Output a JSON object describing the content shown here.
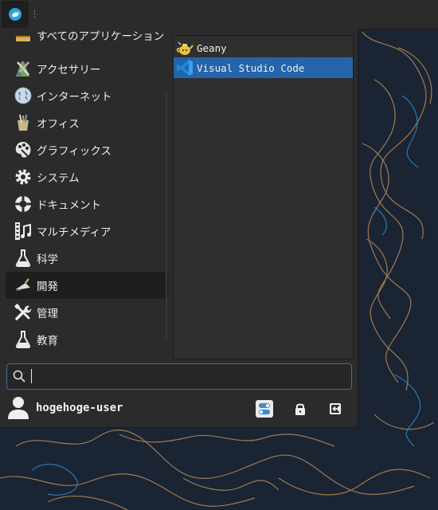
{
  "panel": {
    "menu_button_icon": "xfce-whiskers-icon",
    "separator_glyph": "⋮"
  },
  "categories": [
    {
      "label": "すべてのアプリケーション",
      "icon": "all-apps-icon"
    },
    {
      "label": "アクセサリー",
      "icon": "accessories-icon"
    },
    {
      "label": "インターネット",
      "icon": "globe-icon"
    },
    {
      "label": "オフィス",
      "icon": "office-icon"
    },
    {
      "label": "グラフィックス",
      "icon": "graphics-palette-icon"
    },
    {
      "label": "システム",
      "icon": "gear-icon"
    },
    {
      "label": "ドキュメント",
      "icon": "lifebuoy-icon"
    },
    {
      "label": "マルチメディア",
      "icon": "film-music-icon"
    },
    {
      "label": "科学",
      "icon": "flask-icon"
    },
    {
      "label": "開発",
      "icon": "trowel-icon",
      "active": true
    },
    {
      "label": "管理",
      "icon": "tools-icon"
    },
    {
      "label": "教育",
      "icon": "flask-icon"
    }
  ],
  "apps": [
    {
      "label": "Geany",
      "icon": "geany-teapot-icon"
    },
    {
      "label": "Visual Studio Code",
      "icon": "vscode-icon",
      "selected": true
    }
  ],
  "search": {
    "value": "",
    "placeholder": ""
  },
  "user": {
    "name": "hogehoge-user"
  },
  "actions": [
    "settings-toggle-icon",
    "lock-icon",
    "logout-icon"
  ],
  "colors": {
    "selection": "#2464aa",
    "panel": "#2b2b2b",
    "wallpaper": "#1a2433",
    "contour": "#b88a55"
  }
}
